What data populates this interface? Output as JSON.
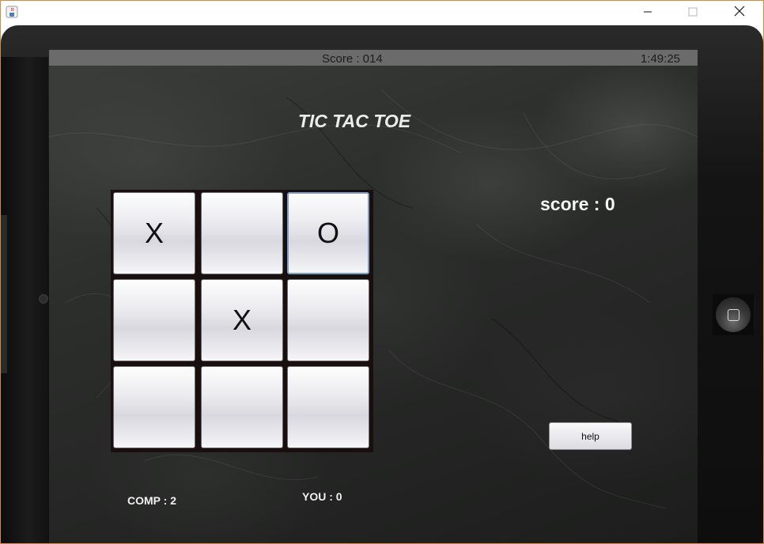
{
  "window": {
    "icon": "java-cup-icon",
    "controls": {
      "minimize": "minimize-icon",
      "maximize": "maximize-icon",
      "close": "close-icon"
    }
  },
  "status_bar": {
    "score": "Score : 014",
    "time": "1:49:25"
  },
  "game": {
    "title": "TIC TAC TOE",
    "board": [
      [
        "X",
        "",
        "O"
      ],
      [
        "",
        "X",
        ""
      ],
      [
        "",
        "",
        ""
      ]
    ],
    "score_label": "score : 0",
    "help_label": "help",
    "comp_score": "COMP : 2",
    "you_score": "YOU : 0"
  },
  "colors": {
    "window_border": "#d78a3c",
    "status_bar": "#6b6b6b",
    "cell_focus": "#7a9cc6"
  }
}
